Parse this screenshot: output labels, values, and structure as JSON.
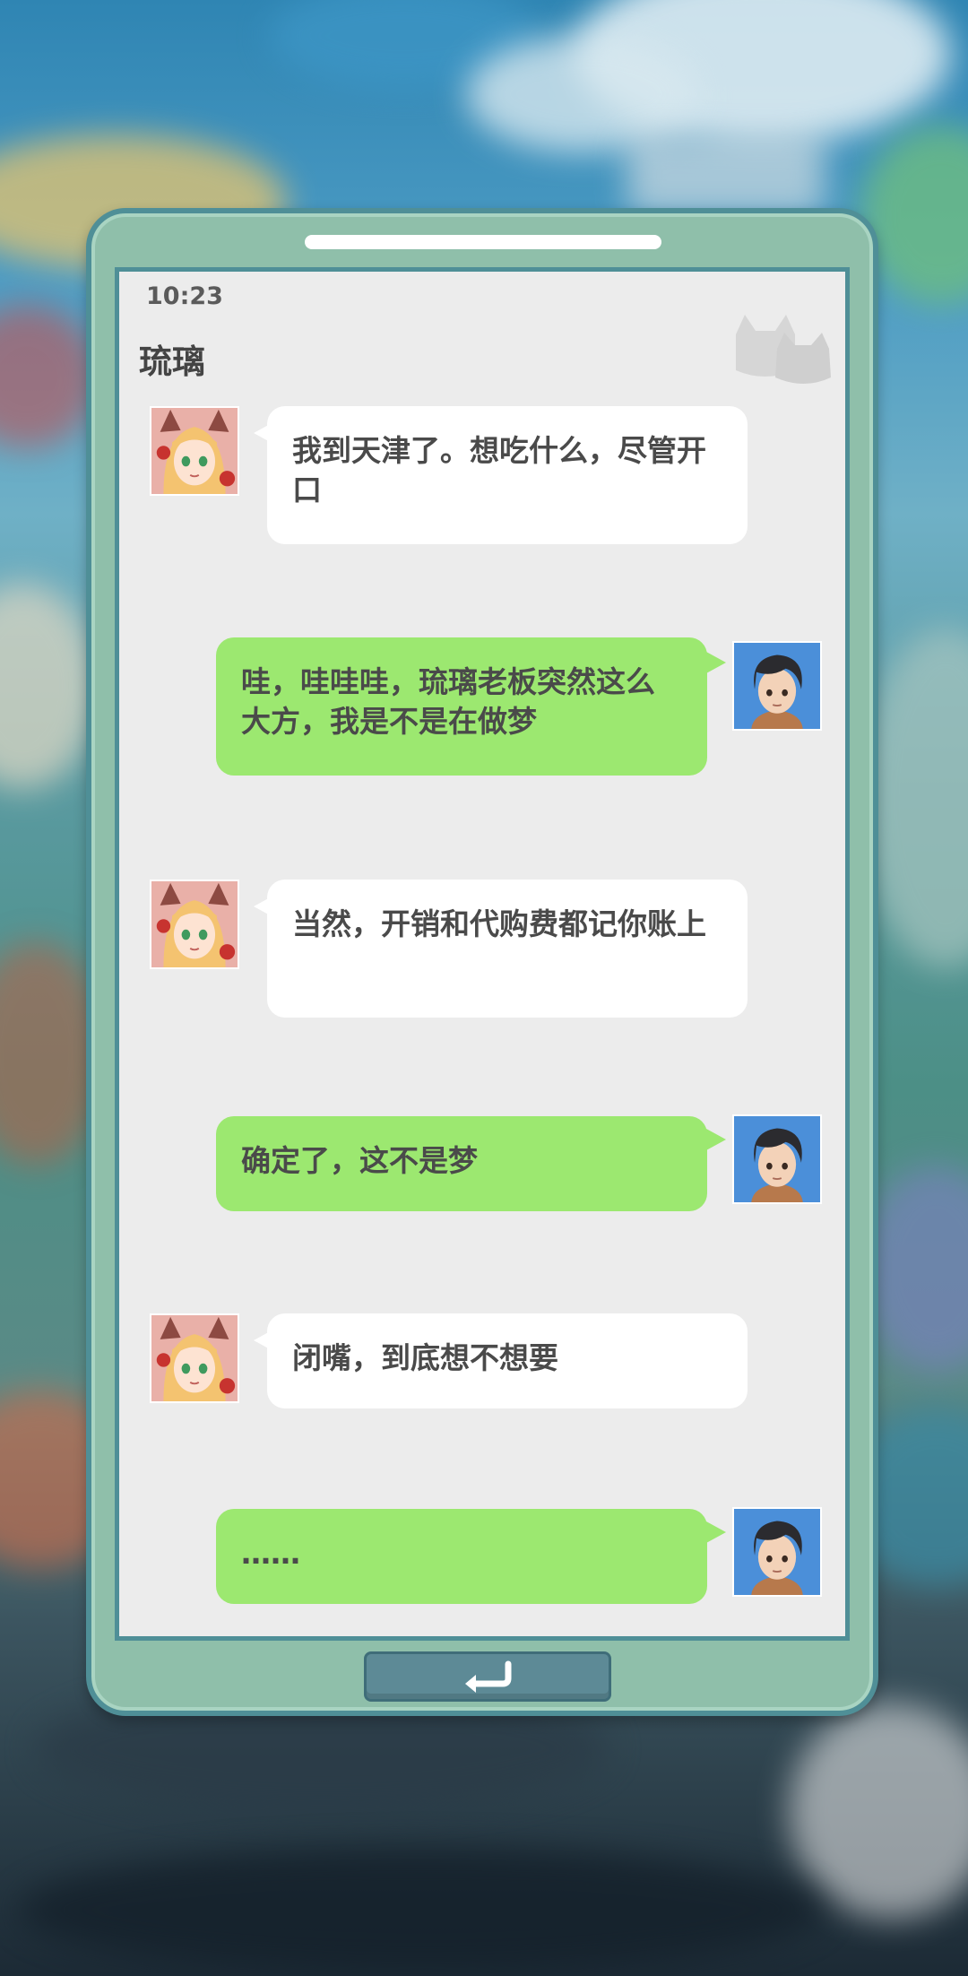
{
  "phone": {
    "time": "10:23",
    "contact_name": "琉璃",
    "header_icon": "cats-silhouette-icon"
  },
  "messages": [
    {
      "sender": "琉璃",
      "side": "left",
      "text": "我到天津了。想吃什么，尽管开口"
    },
    {
      "sender": "player",
      "side": "right",
      "text": "哇，哇哇哇，琉璃老板突然这么大方，我是不是在做梦"
    },
    {
      "sender": "琉璃",
      "side": "left",
      "text": "当然，开销和代购费都记你账上"
    },
    {
      "sender": "player",
      "side": "right",
      "text": "确定了，这不是梦"
    },
    {
      "sender": "琉璃",
      "side": "left",
      "text": "闭嘴，到底想不想要"
    },
    {
      "sender": "player",
      "side": "right",
      "text": "……"
    }
  ],
  "controls": {
    "back_icon": "return-arrow-icon"
  },
  "colors": {
    "screen_bg": "#ececec",
    "incoming_bubble": "#ffffff",
    "outgoing_bubble": "#9ce870",
    "phone_body": "#8fbfaa",
    "phone_border": "#4f8f97",
    "text": "#4a4a4a"
  }
}
